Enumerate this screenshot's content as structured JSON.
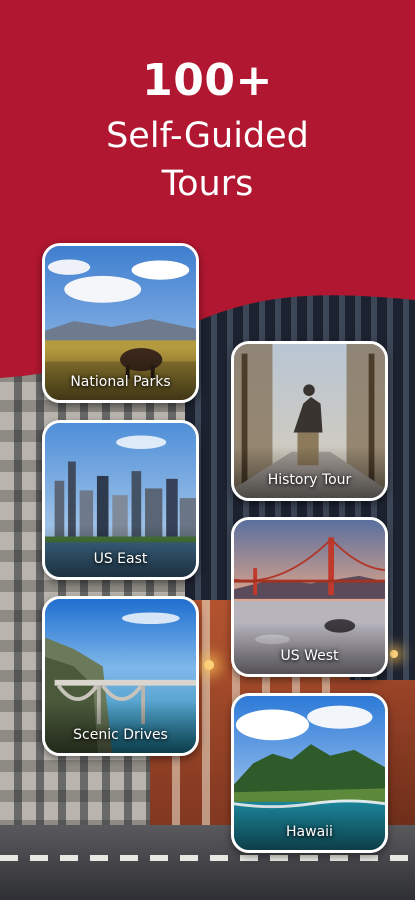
{
  "header": {
    "count": "100+",
    "line1": "Self-Guided",
    "line2": "Tours"
  },
  "colors": {
    "header_red": "#b11730",
    "card_border": "#ffffff",
    "text": "#ffffff"
  },
  "tours": [
    {
      "label": "National Parks",
      "icon": "bison-prairie-photo"
    },
    {
      "label": "History Tour",
      "icon": "equestrian-statue-photo"
    },
    {
      "label": "US East",
      "icon": "city-skyline-photo"
    },
    {
      "label": "US West",
      "icon": "golden-gate-bridge-photo"
    },
    {
      "label": "Scenic Drives",
      "icon": "coastal-bridge-photo"
    },
    {
      "label": "Hawaii",
      "icon": "island-coast-photo"
    }
  ]
}
